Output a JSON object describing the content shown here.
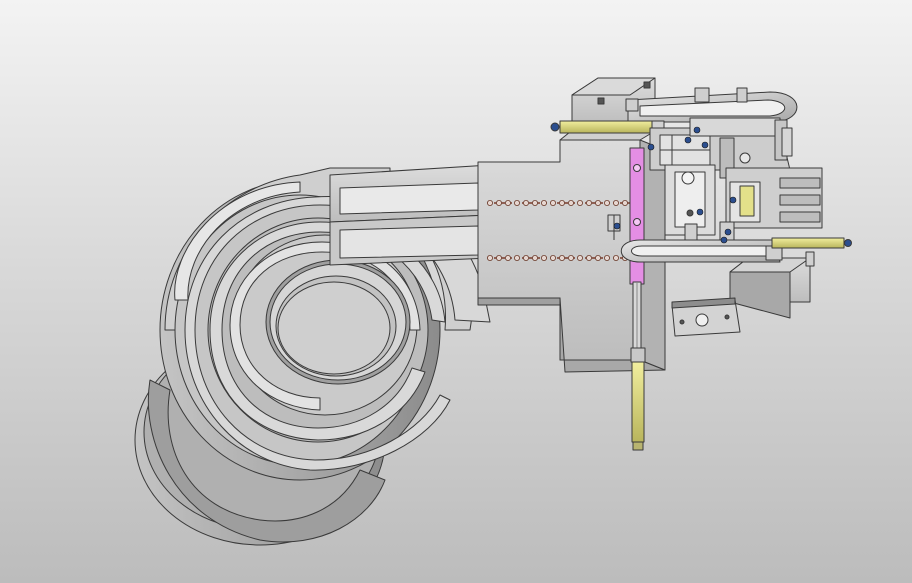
{
  "viewport": {
    "background_top": "#f3f3f3",
    "background_bottom": "#bcbcbc",
    "model_name": "cad-assembly-vibratory-bowl-feeder"
  },
  "colors": {
    "steel": "#d4d4d4",
    "steel_dark": "#9a9a9a",
    "edge": "#3a3a3a",
    "cylinder_yellow": "#e3e08a",
    "guide_magenta": "#e48ee4",
    "fastener_blue": "#2b4e8f"
  },
  "icons": [
    "screw-head-icon",
    "pneumatic-cylinder-icon"
  ]
}
